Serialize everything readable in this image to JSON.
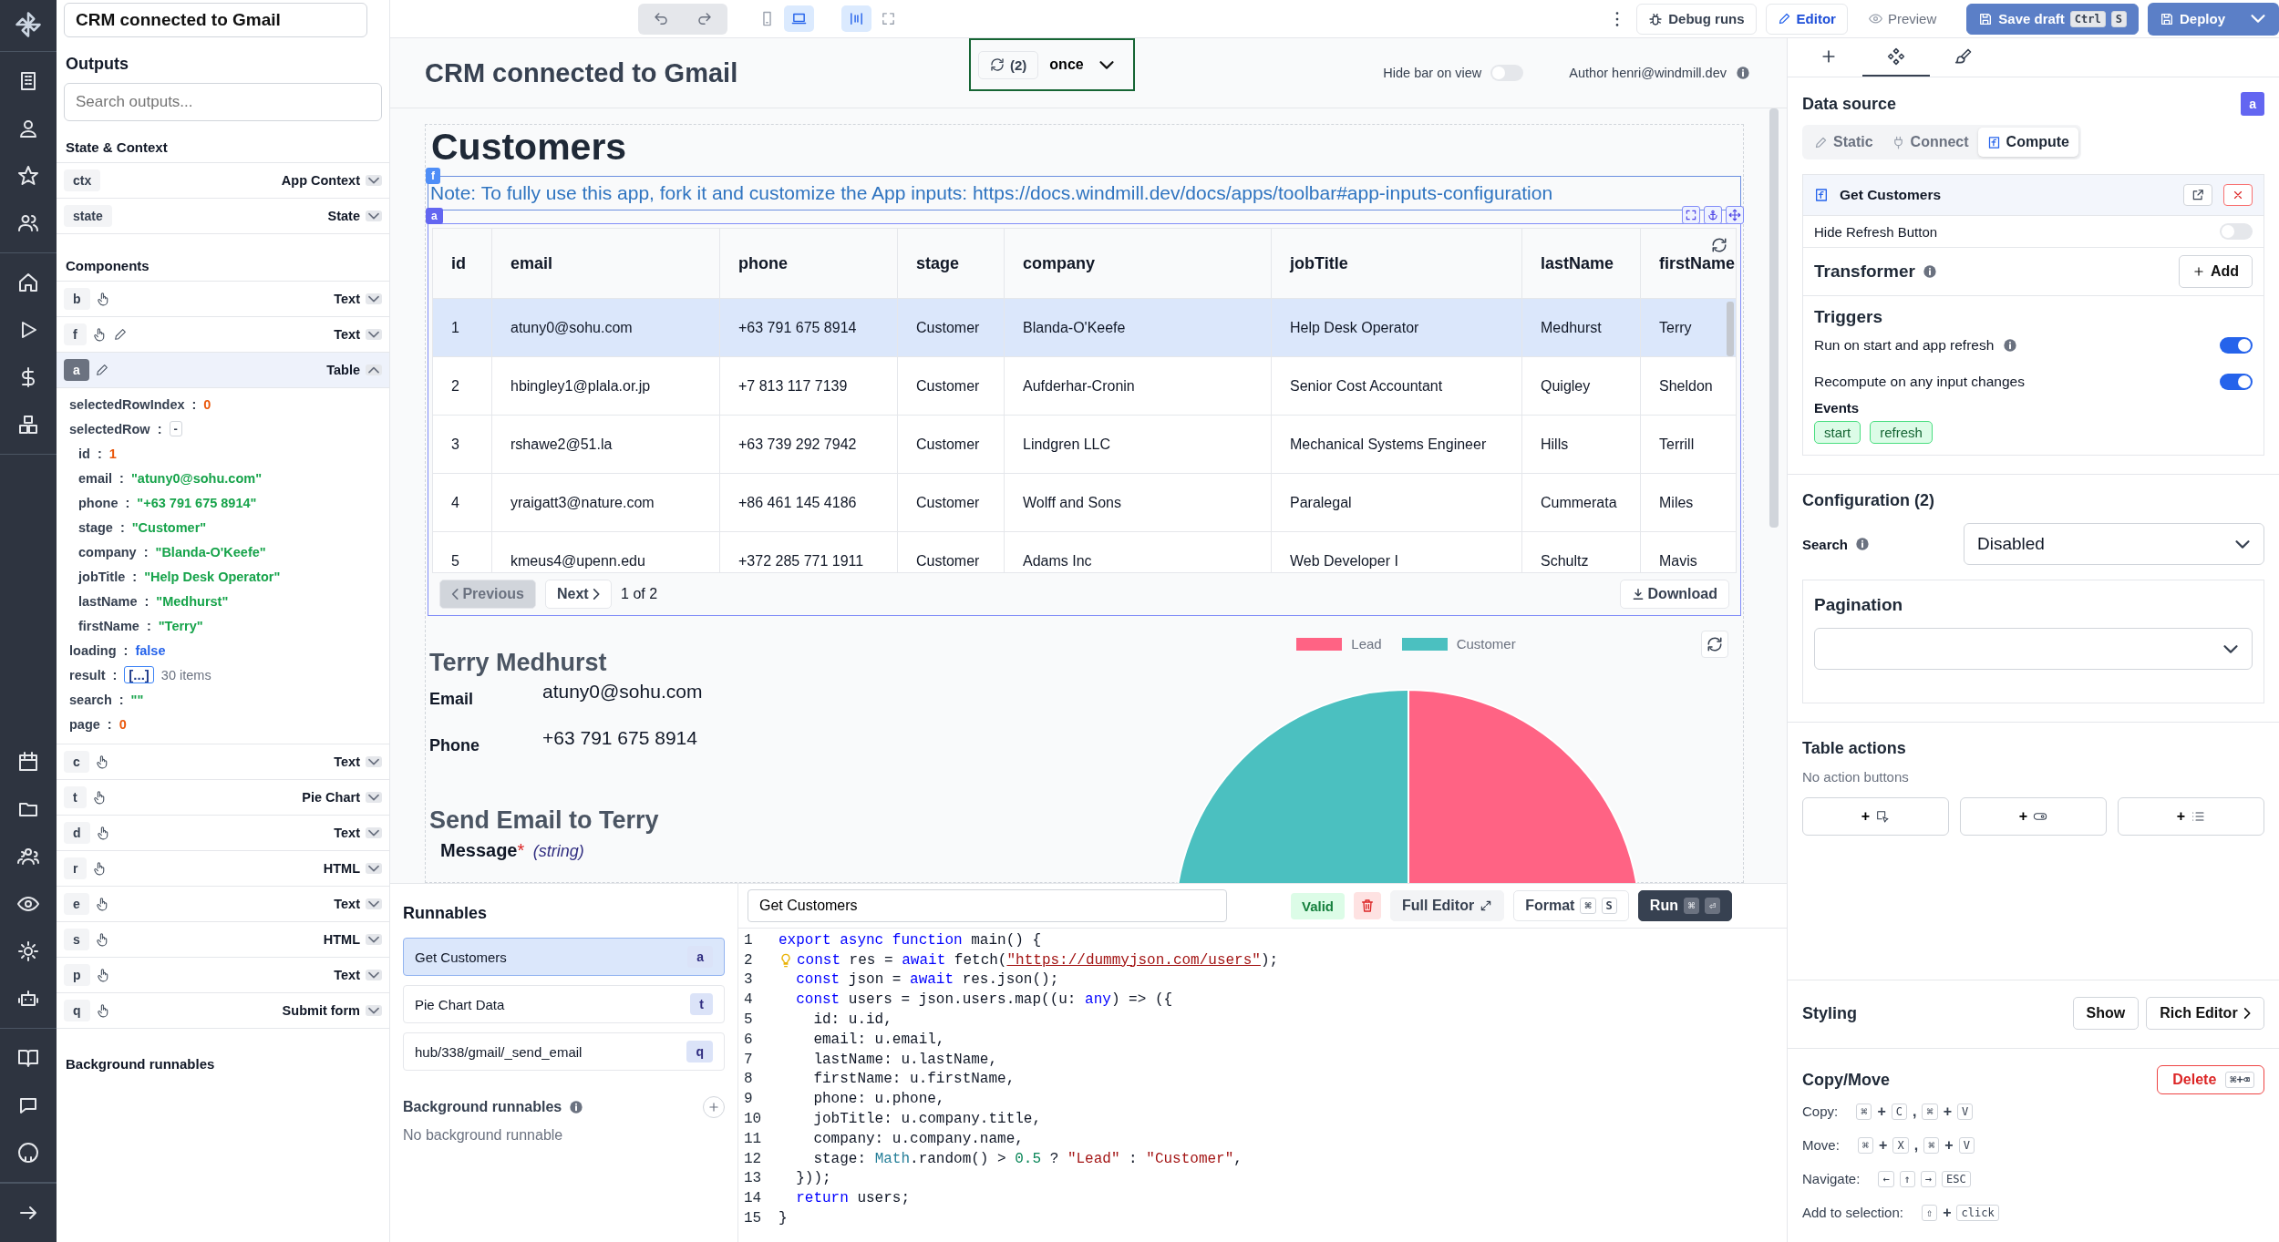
{
  "app_name_field": {
    "value": "CRM connected to Gmail"
  },
  "toolbar": {
    "device_buttons": [
      {
        "selected": false
      },
      {
        "selected": true
      }
    ],
    "layout_buttons": [
      {
        "selected": true
      },
      {
        "selected": false
      }
    ],
    "debug_runs": "Debug runs",
    "modes": [
      {
        "label": "Editor",
        "selected": true
      },
      {
        "label": "Preview",
        "selected": false
      }
    ],
    "save_draft": {
      "label": "Save draft",
      "keys": [
        "Ctrl",
        "S"
      ]
    },
    "deploy": "Deploy"
  },
  "outputs": {
    "title": "Outputs",
    "search_placeholder": "Search outputs...",
    "separator": ":",
    "context_heading": "State & Context",
    "context": [
      {
        "id": "ctx",
        "label": "App Context",
        "expanded": false
      },
      {
        "id": "state",
        "label": "State",
        "expanded": false
      }
    ],
    "components_heading": "Components",
    "components": [
      {
        "id": "b",
        "kind": "hand",
        "label": "Text",
        "selected": false,
        "expanded": false
      },
      {
        "id": "f",
        "kind": "hand-pencil",
        "label": "Text",
        "selected": false,
        "expanded": false
      },
      {
        "id": "a",
        "kind": "pencil",
        "label": "Table",
        "selected": true,
        "expanded": true,
        "fields": [
          {
            "key": "selectedRowIndex",
            "kind": "number",
            "value": "0"
          },
          {
            "key": "selectedRow",
            "kind": "object",
            "toggle": "-",
            "children": [
              {
                "key": "id",
                "kind": "number",
                "value": "1"
              },
              {
                "key": "email",
                "kind": "string",
                "value": "\"atuny0@sohu.com\""
              },
              {
                "key": "phone",
                "kind": "string",
                "value": "\"+63 791 675 8914\""
              },
              {
                "key": "stage",
                "kind": "string",
                "value": "\"Customer\""
              },
              {
                "key": "company",
                "kind": "string",
                "value": "\"Blanda-O'Keefe\""
              },
              {
                "key": "jobTitle",
                "kind": "string",
                "value": "\"Help Desk Operator\""
              },
              {
                "key": "lastName",
                "kind": "string",
                "value": "\"Medhurst\""
              },
              {
                "key": "firstName",
                "kind": "string",
                "value": "\"Terry\""
              }
            ]
          },
          {
            "key": "loading",
            "kind": "boolean",
            "value": "false"
          },
          {
            "key": "result",
            "kind": "array",
            "toggle": "[...]",
            "count": "30 items"
          },
          {
            "key": "search",
            "kind": "string",
            "value": "\"\""
          },
          {
            "key": "page",
            "kind": "number",
            "value": "0"
          }
        ]
      },
      {
        "id": "c",
        "kind": "hand",
        "label": "Text",
        "selected": false,
        "expanded": false
      },
      {
        "id": "t",
        "kind": "hand",
        "label": "Pie Chart",
        "selected": false,
        "expanded": false
      },
      {
        "id": "d",
        "kind": "hand",
        "label": "Text",
        "selected": false,
        "expanded": false
      },
      {
        "id": "r",
        "kind": "hand",
        "label": "HTML",
        "selected": false,
        "expanded": false
      },
      {
        "id": "e",
        "kind": "hand",
        "label": "Text",
        "selected": false,
        "expanded": false
      },
      {
        "id": "s",
        "kind": "hand",
        "label": "HTML",
        "selected": false,
        "expanded": false
      },
      {
        "id": "p",
        "kind": "hand",
        "label": "Text",
        "selected": false,
        "expanded": false
      },
      {
        "id": "q",
        "kind": "hand",
        "label": "Submit form",
        "selected": false,
        "expanded": false
      }
    ],
    "background_heading": "Background runnables"
  },
  "header": {
    "title": "CRM connected to Gmail",
    "refresh_count": "(2)",
    "refresh_mode": "once",
    "hide_bar": {
      "label": "Hide bar on view",
      "on": false
    },
    "author": "Author henri@windmill.dev"
  },
  "canvas": {
    "heading": "Customers",
    "note": {
      "tag": "f",
      "text": "Note: To fully use this app, fork it and customize the App inputs: https://docs.windmill.dev/docs/apps/toolbar#app-inputs-configuration"
    },
    "table": {
      "tag": "a",
      "columns": [
        "id",
        "email",
        "phone",
        "stage",
        "company",
        "jobTitle",
        "lastName",
        "firstName"
      ],
      "rows": [
        {
          "selected": true,
          "cells": [
            "1",
            "atuny0@sohu.com",
            "+63 791 675 8914",
            "Customer",
            "Blanda-O'Keefe",
            "Help Desk Operator",
            "Medhurst",
            "Terry"
          ]
        },
        {
          "selected": false,
          "cells": [
            "2",
            "hbingley1@plala.or.jp",
            "+7 813 117 7139",
            "Customer",
            "Aufderhar-Cronin",
            "Senior Cost Accountant",
            "Quigley",
            "Sheldon"
          ]
        },
        {
          "selected": false,
          "cells": [
            "3",
            "rshawe2@51.la",
            "+63 739 292 7942",
            "Customer",
            "Lindgren LLC",
            "Mechanical Systems Engineer",
            "Hills",
            "Terrill"
          ]
        },
        {
          "selected": false,
          "cells": [
            "4",
            "yraigatt3@nature.com",
            "+86 461 145 4186",
            "Customer",
            "Wolff and Sons",
            "Paralegal",
            "Cummerata",
            "Miles"
          ]
        },
        {
          "selected": false,
          "cells": [
            "5",
            "kmeus4@upenn.edu",
            "+372 285 771 1911",
            "Customer",
            "Adams Inc",
            "Web Developer I",
            "Schultz",
            "Mavis"
          ]
        }
      ],
      "pagination": {
        "previous": "Previous",
        "previous_disabled": true,
        "next": "Next",
        "page": "1 of 2",
        "download": "Download"
      }
    },
    "detail": {
      "name": "Terry Medhurst",
      "fields": [
        {
          "label": "Email",
          "value": "atuny0@sohu.com"
        },
        {
          "label": "Phone",
          "value": "+63 791 675 8914"
        }
      ]
    },
    "email_form": {
      "heading": "Send Email to Terry",
      "field": {
        "label": "Message",
        "required": "*",
        "type": "(string)"
      }
    },
    "pie": {
      "legend": [
        {
          "label": "Lead",
          "color": "#ff6384"
        },
        {
          "label": "Customer",
          "color": "#4bc0c0"
        }
      ]
    }
  },
  "runnables": {
    "title": "Runnables",
    "items": [
      {
        "name": "Get Customers",
        "tag": "a",
        "selected": true
      },
      {
        "name": "Pie Chart Data",
        "tag": "t",
        "selected": false
      },
      {
        "name": "hub/338/gmail/_send_email",
        "tag": "q",
        "selected": false
      }
    ],
    "background_title": "Background runnables",
    "background_empty": "No background runnable"
  },
  "editor": {
    "name": "Get Customers",
    "status": "Valid",
    "full_editor": "Full Editor",
    "format": {
      "label": "Format",
      "keys": [
        "⌘",
        "S"
      ]
    },
    "run": {
      "label": "Run",
      "keys": [
        "⌘",
        "⏎"
      ]
    },
    "lines": [
      {
        "no": "1",
        "hint": false,
        "parts": [
          {
            "kind": "keyword",
            "text": "export async function"
          },
          {
            "kind": "plain",
            "text": " main() {"
          }
        ]
      },
      {
        "no": "2",
        "hint": true,
        "parts": [
          {
            "kind": "keyword",
            "text": "const"
          },
          {
            "kind": "plain",
            "text": " res = "
          },
          {
            "kind": "keyword",
            "text": "await"
          },
          {
            "kind": "plain",
            "text": " fetch("
          },
          {
            "kind": "link",
            "text": "\"https://dummyjson.com/users\""
          },
          {
            "kind": "plain",
            "text": ");"
          }
        ]
      },
      {
        "no": "3",
        "hint": false,
        "parts": [
          {
            "kind": "keyword",
            "text": "  const"
          },
          {
            "kind": "plain",
            "text": " json = "
          },
          {
            "kind": "keyword",
            "text": "await"
          },
          {
            "kind": "plain",
            "text": " res.json();"
          }
        ]
      },
      {
        "no": "4",
        "hint": false,
        "parts": [
          {
            "kind": "keyword",
            "text": "  const"
          },
          {
            "kind": "plain",
            "text": " users = json.users.map((u: "
          },
          {
            "kind": "keyword",
            "text": "any"
          },
          {
            "kind": "plain",
            "text": ") => ({"
          }
        ]
      },
      {
        "no": "5",
        "hint": false,
        "parts": [
          {
            "kind": "plain",
            "text": "    id: u.id,"
          }
        ]
      },
      {
        "no": "6",
        "hint": false,
        "parts": [
          {
            "kind": "plain",
            "text": "    email: u.email,"
          }
        ]
      },
      {
        "no": "7",
        "hint": false,
        "parts": [
          {
            "kind": "plain",
            "text": "    lastName: u.lastName,"
          }
        ]
      },
      {
        "no": "8",
        "hint": false,
        "parts": [
          {
            "kind": "plain",
            "text": "    firstName: u.firstName,"
          }
        ]
      },
      {
        "no": "9",
        "hint": false,
        "parts": [
          {
            "kind": "plain",
            "text": "    phone: u.phone,"
          }
        ]
      },
      {
        "no": "10",
        "hint": false,
        "parts": [
          {
            "kind": "plain",
            "text": "    jobTitle: u.company.title,"
          }
        ]
      },
      {
        "no": "11",
        "hint": false,
        "parts": [
          {
            "kind": "plain",
            "text": "    company: u.company.name,"
          }
        ]
      },
      {
        "no": "12",
        "hint": false,
        "parts": [
          {
            "kind": "plain",
            "text": "    stage: "
          },
          {
            "kind": "class",
            "text": "Math"
          },
          {
            "kind": "plain",
            "text": ".random() > "
          },
          {
            "kind": "number",
            "text": "0.5"
          },
          {
            "kind": "plain",
            "text": " ? "
          },
          {
            "kind": "string",
            "text": "\"Lead\""
          },
          {
            "kind": "plain",
            "text": " : "
          },
          {
            "kind": "string",
            "text": "\"Customer\""
          },
          {
            "kind": "plain",
            "text": ","
          }
        ]
      },
      {
        "no": "13",
        "hint": false,
        "parts": [
          {
            "kind": "plain",
            "text": "  }));"
          }
        ]
      },
      {
        "no": "14",
        "hint": false,
        "parts": [
          {
            "kind": "keyword",
            "text": "  return"
          },
          {
            "kind": "plain",
            "text": " users;"
          }
        ]
      },
      {
        "no": "15",
        "hint": false,
        "parts": [
          {
            "kind": "plain",
            "text": "}"
          }
        ]
      }
    ]
  },
  "inspector": {
    "tabs": [
      {
        "selected": false
      },
      {
        "selected": true
      },
      {
        "selected": false
      }
    ],
    "data_source": {
      "title": "Data source",
      "tag": "a",
      "modes": [
        {
          "label": "Static",
          "selected": false
        },
        {
          "label": "Connect",
          "selected": false
        },
        {
          "label": "Compute",
          "selected": true
        }
      ],
      "runnable": "Get Customers",
      "hide_refresh": {
        "label": "Hide Refresh Button",
        "on": false
      },
      "transformer": "Transformer",
      "add": "Add",
      "triggers_title": "Triggers",
      "triggers": [
        {
          "label": "Run on start and app refresh",
          "info": true,
          "on": true
        },
        {
          "label": "Recompute on any input changes",
          "info": false,
          "on": true
        }
      ],
      "events_title": "Events",
      "events": [
        "start",
        "refresh"
      ]
    },
    "configuration": {
      "title": "Configuration (2)",
      "search": {
        "label": "Search",
        "value": "Disabled"
      },
      "pagination_title": "Pagination"
    },
    "table_actions": {
      "title": "Table actions",
      "empty": "No action buttons",
      "add_buttons": [
        "+",
        "+",
        "+"
      ]
    },
    "styling": {
      "title": "Styling",
      "show": "Show",
      "rich_editor": "Rich Editor"
    },
    "copy_move": {
      "title": "Copy/Move",
      "delete": "Delete",
      "delete_keys": "⌘+⌫",
      "shortcuts": [
        {
          "label": "Copy:",
          "parts": [
            {
              "kind": "key",
              "text": "⌘"
            },
            {
              "kind": "sep",
              "text": "+"
            },
            {
              "kind": "key",
              "text": "C"
            },
            {
              "kind": "sep",
              "text": ","
            },
            {
              "kind": "key",
              "text": "⌘"
            },
            {
              "kind": "sep",
              "text": "+"
            },
            {
              "kind": "key",
              "text": "V"
            }
          ]
        },
        {
          "label": "Move:",
          "parts": [
            {
              "kind": "key",
              "text": "⌘"
            },
            {
              "kind": "sep",
              "text": "+"
            },
            {
              "kind": "key",
              "text": "X"
            },
            {
              "kind": "sep",
              "text": ","
            },
            {
              "kind": "key",
              "text": "⌘"
            },
            {
              "kind": "sep",
              "text": "+"
            },
            {
              "kind": "key",
              "text": "V"
            }
          ]
        },
        {
          "label": "Navigate:",
          "parts": [
            {
              "kind": "key",
              "text": "←"
            },
            {
              "kind": "key",
              "text": "↑"
            },
            {
              "kind": "key",
              "text": "→"
            },
            {
              "kind": "key",
              "text": "ESC"
            }
          ]
        },
        {
          "label": "Add to selection:",
          "parts": [
            {
              "kind": "key",
              "text": "⇧"
            },
            {
              "kind": "sep",
              "text": "+"
            },
            {
              "kind": "key",
              "text": "click"
            }
          ]
        }
      ]
    }
  }
}
